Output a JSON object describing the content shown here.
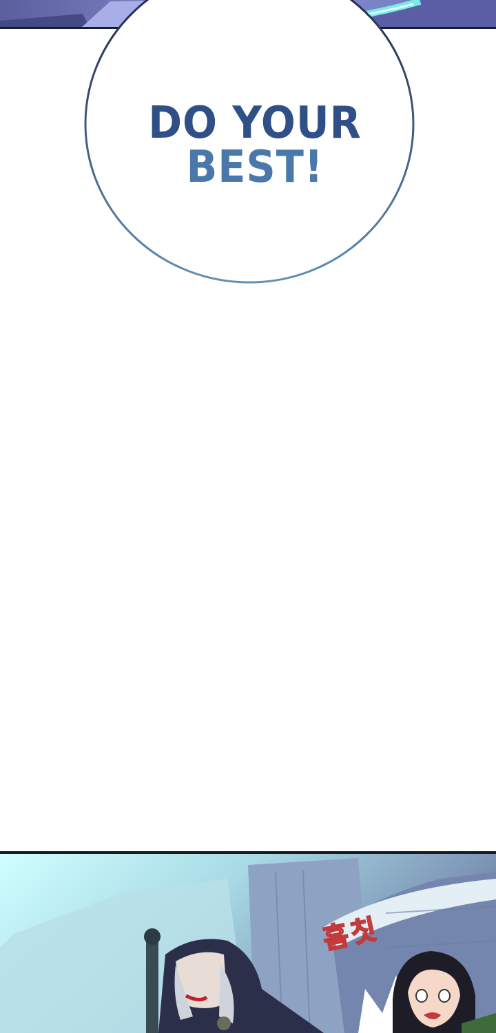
{
  "speech_bubble": {
    "lines": [
      "DO YOUR",
      "BEST!"
    ],
    "colors": {
      "line1": "#2f4f86",
      "line2": "#4a78aa",
      "outline_top": "#1c2140",
      "outline_bottom": "#5f90b8"
    }
  },
  "panels": {
    "top": {
      "description_colors": {
        "sky": "#7f86c9",
        "glow": "#6ff0e6",
        "border": "#1a1a2a"
      }
    },
    "bottom": {
      "sound_effect": "흠칫",
      "sound_effect_color": "#c23a3a",
      "description_colors": {
        "sky": "#bfeff0",
        "building": "#7d8fb2",
        "cloak": "#2c2f4a",
        "hair": "#1e1c26"
      }
    }
  }
}
